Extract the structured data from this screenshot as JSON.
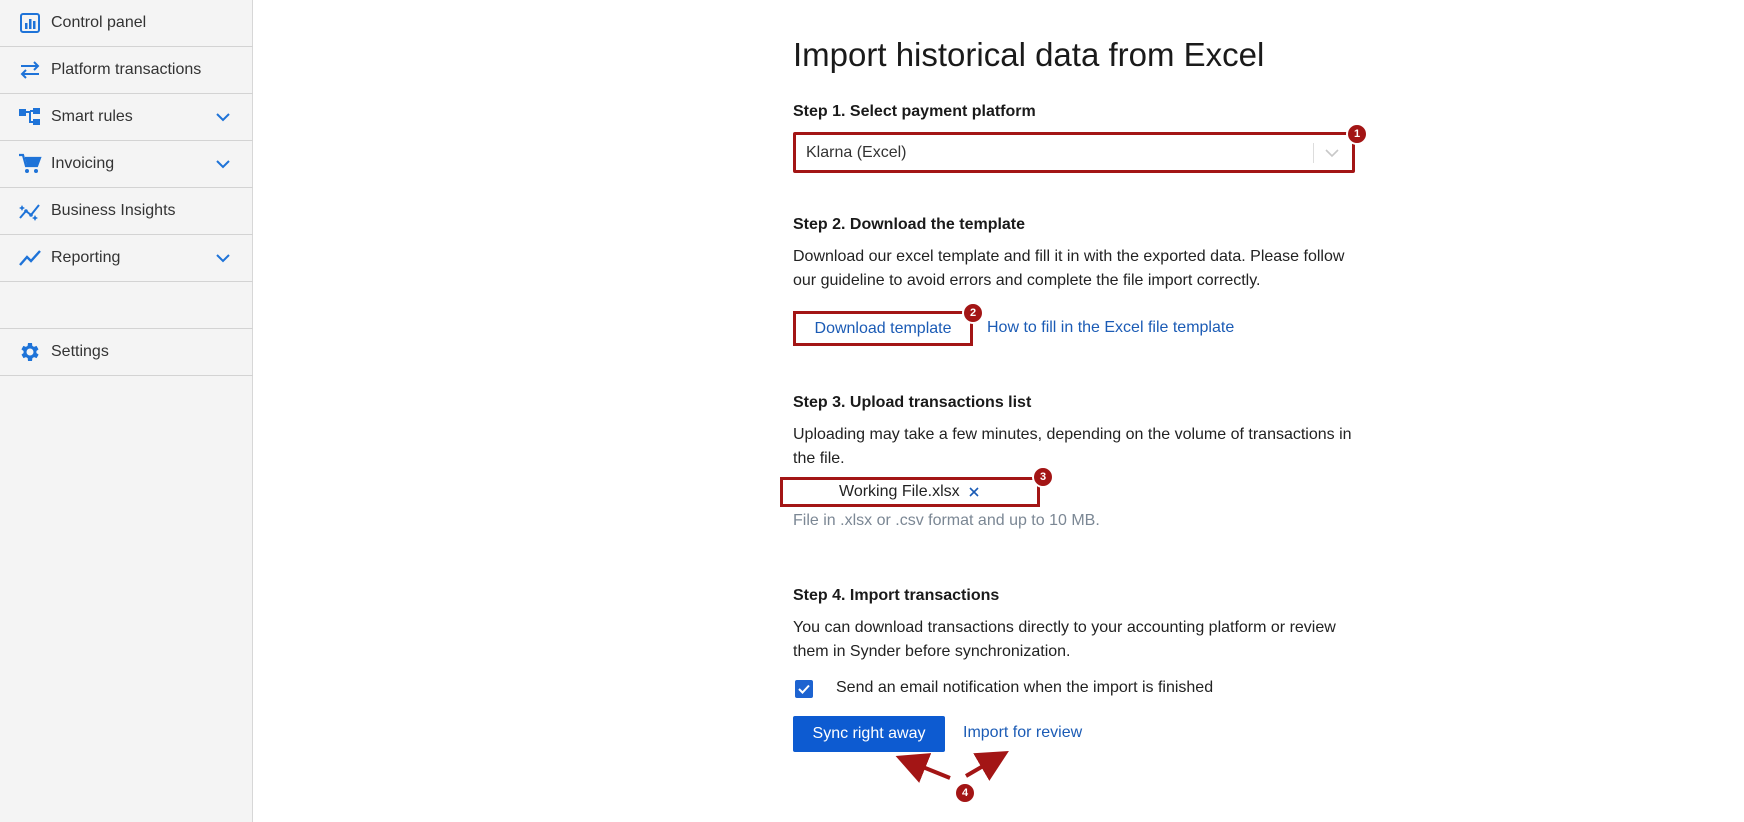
{
  "sidebar": {
    "items": [
      {
        "label": "Control panel",
        "icon": "dashboard-icon"
      },
      {
        "label": "Platform transactions",
        "icon": "transfer-arrows-icon"
      },
      {
        "label": "Smart rules",
        "icon": "hierarchy-icon",
        "expandable": true
      },
      {
        "label": "Invoicing",
        "icon": "cart-icon",
        "expandable": true
      },
      {
        "label": "Business Insights",
        "icon": "insights-icon"
      },
      {
        "label": "Reporting",
        "icon": "trend-line-icon",
        "expandable": true
      },
      {
        "label": "Settings",
        "icon": "gear-icon"
      }
    ]
  },
  "main": {
    "title": "Import historical data from Excel",
    "step1": {
      "heading": "Step 1. Select payment platform",
      "selected": "Klarna (Excel)"
    },
    "step2": {
      "heading": "Step 2. Download the template",
      "description": "Download our excel template and fill it in with the exported data. Please follow our guideline to avoid errors and complete the file import correctly.",
      "download_label": "Download template",
      "guide_link": "How to fill in the Excel file template"
    },
    "step3": {
      "heading": "Step 3. Upload transactions list",
      "description": "Uploading may take a few minutes, depending on the volume of transactions in the file.",
      "file_name": "Working File.xlsx",
      "hint": "File in .xlsx or .csv format and up to 10 MB."
    },
    "step4": {
      "heading": "Step 4. Import transactions",
      "description": "You can download transactions directly to your accounting platform or review them in Synder before synchronization.",
      "email_notification_label": "Send an email notification when the import is finished",
      "email_notification_checked": true,
      "sync_label": "Sync right away",
      "review_link": "Import for review"
    }
  },
  "annotations": {
    "badges": [
      "1",
      "2",
      "3",
      "4"
    ],
    "color": "#a31515"
  },
  "colors": {
    "accent": "#0d5bd1",
    "link": "#1b5bb5",
    "icon": "#1e73d8",
    "annotation": "#a31515"
  }
}
